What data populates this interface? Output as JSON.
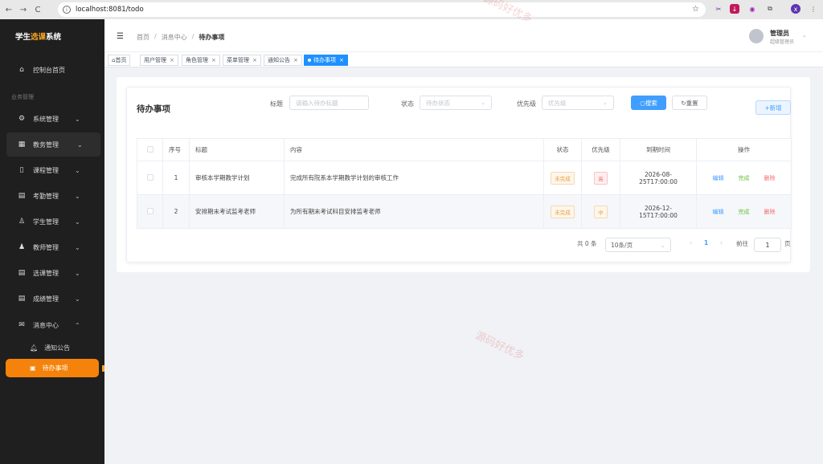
{
  "browser": {
    "url": "localhost:8081/todo",
    "back": "←",
    "forward": "→",
    "reload": "C"
  },
  "sidebar": {
    "brand_prefix": "学生",
    "brand_accent": "选课",
    "brand_suffix": "系统",
    "dashboard": "控制台首页",
    "section": "业务管理",
    "items": [
      {
        "label": "系统管理",
        "icon": "gear-icon"
      },
      {
        "label": "教务管理",
        "icon": "building-icon"
      },
      {
        "label": "课程管理",
        "icon": "book-icon"
      },
      {
        "label": "考勤管理",
        "icon": "calendar-icon"
      },
      {
        "label": "学生管理",
        "icon": "user-icon"
      },
      {
        "label": "教师管理",
        "icon": "person-icon"
      },
      {
        "label": "选课管理",
        "icon": "calendar-icon"
      },
      {
        "label": "成绩管理",
        "icon": "calendar-icon"
      },
      {
        "label": "消息中心",
        "icon": "mail-icon"
      }
    ],
    "sub_notice": "通知公告",
    "sub_todo": "待办事项"
  },
  "header": {
    "crumb_home": "首页",
    "crumb_msg": "消息中心",
    "crumb_current": "待办事项",
    "user_name": "管理员",
    "user_role": "超级管理员"
  },
  "tags": {
    "home": "首页",
    "users": "用户管理",
    "roles": "角色管理",
    "menus": "菜单管理",
    "notices": "通知公告",
    "todo": "待办事项"
  },
  "page": {
    "title": "待办事项",
    "filter_title_label": "标题",
    "filter_title_placeholder": "请输入待办标题",
    "filter_status_label": "状态",
    "filter_status_placeholder": "待办状态",
    "filter_priority_label": "优先级",
    "filter_priority_placeholder": "优先级",
    "search_btn": "搜索",
    "reset_btn": "重置",
    "add_btn": "+新增"
  },
  "table": {
    "headers": [
      "序号",
      "标题",
      "内容",
      "状态",
      "优先级",
      "到期时间",
      "操作"
    ],
    "rows": [
      {
        "idx": "1",
        "title": "审核本学期教学计划",
        "content": "完成所有院系本学期教学计划的审核工作",
        "status": "未完成",
        "priority": "高",
        "due1": "2026-08-",
        "due2": "25T17:00:00"
      },
      {
        "idx": "2",
        "title": "安排期末考试监考老师",
        "content": "为所有期末考试科目安排监考老师",
        "status": "未完成",
        "priority": "中",
        "due1": "2026-12-",
        "due2": "15T17:00:00"
      }
    ],
    "op_edit": "编辑",
    "op_done": "完成",
    "op_delete": "删除"
  },
  "pagination": {
    "total": "共 0 条",
    "page_size": "10条/页",
    "prev": "‹",
    "current": "1",
    "next": "›",
    "goto_label": "前往",
    "goto_value": "1",
    "page_suffix": "页"
  },
  "watermark": "源码好优多",
  "colors": {
    "accent": "#f5820a",
    "primary": "#409eff"
  }
}
